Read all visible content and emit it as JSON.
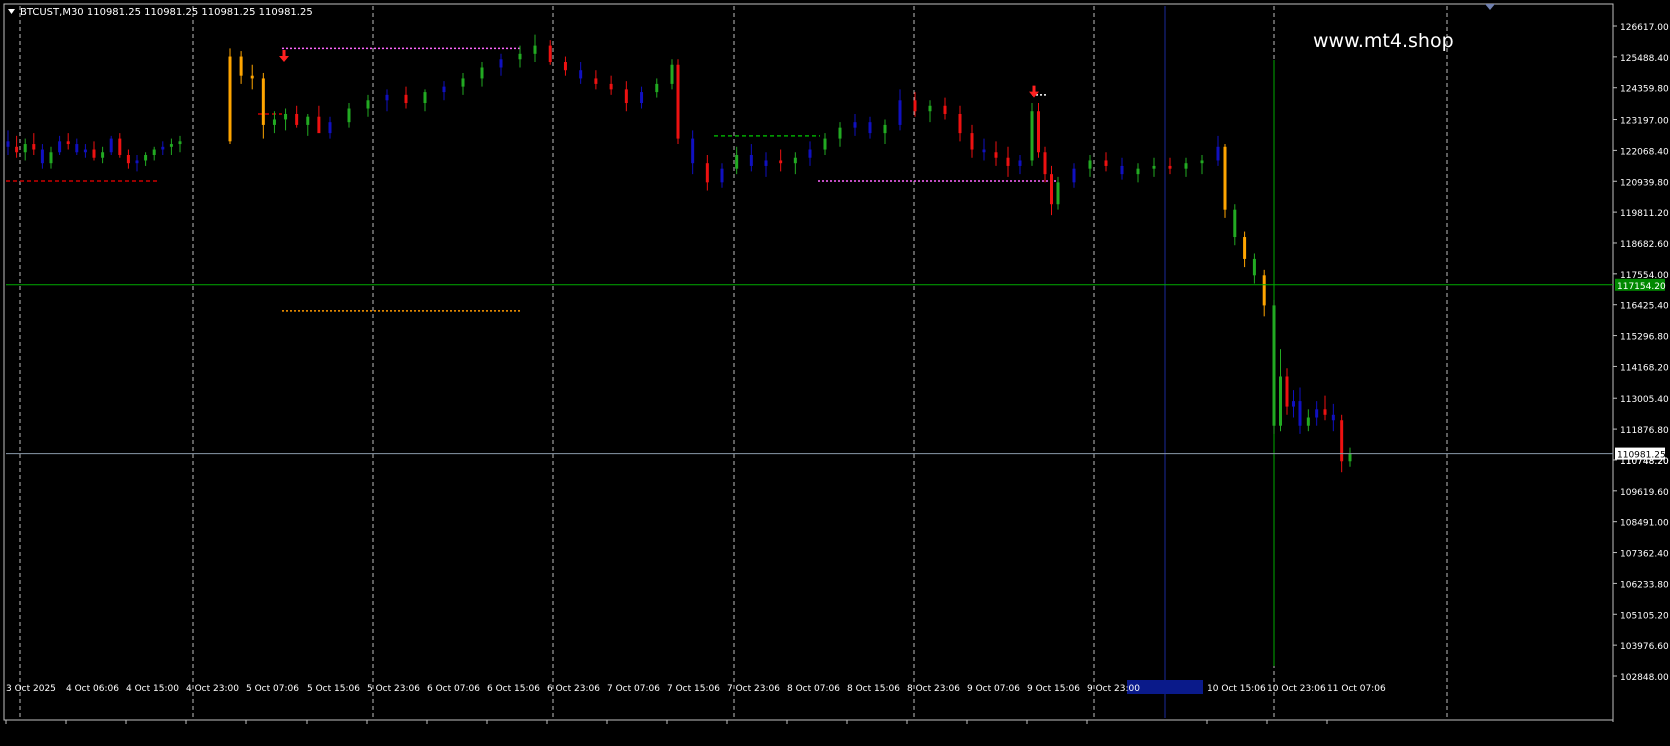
{
  "header": {
    "symbol_info": "BTCUST,M30  110981.25 110981.25 110981.25 110981.25",
    "menu_icon": "triangle-down-icon",
    "top_marker_icon": "triangle-down-icon"
  },
  "watermark": "www.mt4.shop",
  "chart_data": {
    "type": "candlestick",
    "symbol": "BTCUST",
    "timeframe": "M30",
    "ohlc": {
      "open": 110981.25,
      "high": 110981.25,
      "low": 110981.25,
      "close": 110981.25
    },
    "ylim": [
      102848.0,
      126900.0
    ],
    "y_ticks": [
      126617.0,
      125488.4,
      124359.8,
      123197.0,
      122068.4,
      120939.8,
      119811.2,
      118682.6,
      117554.0,
      116425.4,
      115296.8,
      114168.2,
      113005.4,
      111876.8,
      110748.2,
      109619.6,
      108491.0,
      107362.4,
      106233.8,
      105105.2,
      103976.6,
      102848.0
    ],
    "y_tick_labels": [
      "126617.00",
      "125488.40",
      "124359.80",
      "123197.00",
      "122068.40",
      "120939.80",
      "119811.20",
      "118682.60",
      "117554.00",
      "116425.40",
      "115296.80",
      "114168.20",
      "113005.40",
      "111876.80",
      "110748.20",
      "109619.60",
      "108491.00",
      "107362.40",
      "106233.80",
      "105105.20",
      "103976.60",
      "102848.00"
    ],
    "x_labels": [
      "3 Oct 2025",
      "4 Oct 06:06",
      "4 Oct 15:00",
      "4 Oct 23:00",
      "5 Oct 07:06",
      "5 Oct 15:06",
      "5 Oct 23:06",
      "6 Oct 07:06",
      "6 Oct 15:06",
      "6 Oct 23:06",
      "7 Oct 07:06",
      "7 Oct 15:06",
      "7 Oct 23:06",
      "8 Oct 07:06",
      "8 Oct 15:06",
      "8 Oct 23:06",
      "9 Oct 07:06",
      "9 Oct 15:06",
      "9 Oct 23:00",
      "10 Oct 15:06",
      "10 Oct 23:06",
      "11 Oct 07:06"
    ],
    "current_price": 110981.25,
    "current_price_label": "110981.25",
    "green_level": 117154.2,
    "green_level_label": "117154.20",
    "overlay_price_label": "110748.20",
    "candles": [
      [
        0,
        122400,
        122800,
        121900,
        122200
      ],
      [
        1,
        122200,
        122600,
        121800,
        122000
      ],
      [
        2,
        122000,
        122500,
        121700,
        122300
      ],
      [
        3,
        122300,
        122700,
        121900,
        122100
      ],
      [
        4,
        122100,
        122300,
        121400,
        121600
      ],
      [
        5,
        121600,
        122200,
        121400,
        122000
      ],
      [
        6,
        122000,
        122600,
        121900,
        122400
      ],
      [
        7,
        122400,
        122700,
        122100,
        122300
      ],
      [
        8,
        122300,
        122500,
        121900,
        122000
      ],
      [
        9,
        122000,
        122300,
        121800,
        122100
      ],
      [
        10,
        122100,
        122400,
        121700,
        121800
      ],
      [
        11,
        121800,
        122200,
        121600,
        122000
      ],
      [
        12,
        122000,
        122600,
        121900,
        122500
      ],
      [
        13,
        122500,
        122700,
        121800,
        121900
      ],
      [
        14,
        121900,
        122100,
        121400,
        121600
      ],
      [
        15,
        121600,
        121900,
        121300,
        121700
      ],
      [
        16,
        121700,
        122000,
        121500,
        121900
      ],
      [
        17,
        121900,
        122200,
        121700,
        122100
      ],
      [
        18,
        122100,
        122400,
        121900,
        122200
      ],
      [
        19,
        122200,
        122500,
        121900,
        122300
      ],
      [
        20,
        122300,
        122600,
        122000,
        122400
      ],
      [
        21,
        122400,
        125800,
        122300,
        125500
      ],
      [
        22,
        125500,
        125700,
        124500,
        124800
      ],
      [
        23,
        124800,
        125200,
        124300,
        124700
      ],
      [
        24,
        124700,
        124900,
        122500,
        123000
      ],
      [
        25,
        123000,
        123500,
        122700,
        123200
      ],
      [
        26,
        123200,
        123600,
        122800,
        123400
      ],
      [
        27,
        123400,
        123700,
        122900,
        123000
      ],
      [
        28,
        123000,
        123400,
        122600,
        123300
      ],
      [
        29,
        123300,
        123700,
        122900,
        122700
      ],
      [
        30,
        122700,
        123300,
        122500,
        123100
      ],
      [
        31,
        123100,
        123800,
        122900,
        123600
      ],
      [
        32,
        123600,
        124100,
        123300,
        123900
      ],
      [
        33,
        123900,
        124300,
        123500,
        124100
      ],
      [
        34,
        124100,
        124400,
        123600,
        123800
      ],
      [
        35,
        123800,
        124300,
        123500,
        124200
      ],
      [
        36,
        124200,
        124600,
        123900,
        124400
      ],
      [
        37,
        124400,
        124900,
        124100,
        124700
      ],
      [
        38,
        124700,
        125300,
        124400,
        125100
      ],
      [
        39,
        125100,
        125600,
        124800,
        125400
      ],
      [
        40,
        125400,
        125900,
        125100,
        125600
      ],
      [
        41,
        125600,
        126300,
        125300,
        125900
      ],
      [
        42,
        125900,
        126100,
        125200,
        125300
      ],
      [
        43,
        125300,
        125500,
        124800,
        125000
      ],
      [
        44,
        125000,
        125300,
        124500,
        124700
      ],
      [
        45,
        124700,
        125000,
        124300,
        124500
      ],
      [
        46,
        124500,
        124800,
        124100,
        124300
      ],
      [
        47,
        124300,
        124600,
        123500,
        123800
      ],
      [
        48,
        123800,
        124400,
        123600,
        124200
      ],
      [
        49,
        124200,
        124700,
        124000,
        124500
      ],
      [
        50,
        124500,
        125400,
        124300,
        125200
      ],
      [
        51,
        125200,
        125400,
        122300,
        122500
      ],
      [
        52,
        122500,
        122800,
        121200,
        121600
      ],
      [
        53,
        121600,
        121900,
        120600,
        120900
      ],
      [
        54,
        120900,
        121600,
        120700,
        121400
      ],
      [
        55,
        121400,
        122200,
        121200,
        121900
      ],
      [
        56,
        121900,
        122300,
        121300,
        121500
      ],
      [
        57,
        121500,
        122000,
        121100,
        121700
      ],
      [
        58,
        121700,
        122100,
        121300,
        121600
      ],
      [
        59,
        121600,
        122000,
        121200,
        121800
      ],
      [
        60,
        121800,
        122400,
        121500,
        122100
      ],
      [
        61,
        122100,
        122700,
        121900,
        122500
      ],
      [
        62,
        122500,
        123100,
        122200,
        122900
      ],
      [
        63,
        122900,
        123400,
        122600,
        123100
      ],
      [
        64,
        123100,
        123300,
        122500,
        122700
      ],
      [
        65,
        122700,
        123200,
        122300,
        123000
      ],
      [
        66,
        123000,
        124300,
        122800,
        123900
      ],
      [
        67,
        123900,
        124200,
        123300,
        123500
      ],
      [
        68,
        123500,
        123900,
        123100,
        123700
      ],
      [
        69,
        123700,
        124000,
        123200,
        123400
      ],
      [
        70,
        123400,
        123700,
        122400,
        122700
      ],
      [
        71,
        122700,
        123000,
        121800,
        122100
      ],
      [
        72,
        122100,
        122500,
        121700,
        122000
      ],
      [
        73,
        122000,
        122400,
        121500,
        121800
      ],
      [
        74,
        121800,
        122200,
        121100,
        121500
      ],
      [
        75,
        121500,
        121900,
        121200,
        121700
      ],
      [
        76,
        121700,
        123800,
        121500,
        123500
      ],
      [
        77,
        123500,
        123800,
        121800,
        122000
      ],
      [
        78,
        122000,
        122200,
        120900,
        121200
      ],
      [
        79,
        121200,
        121500,
        119700,
        120100
      ],
      [
        80,
        120100,
        121100,
        119900,
        120900
      ],
      [
        81,
        120900,
        121600,
        120700,
        121400
      ],
      [
        82,
        121400,
        121900,
        121100,
        121700
      ],
      [
        83,
        121700,
        122000,
        121300,
        121500
      ],
      [
        84,
        121500,
        121800,
        121000,
        121200
      ],
      [
        85,
        121200,
        121600,
        120900,
        121400
      ],
      [
        86,
        121400,
        121800,
        121100,
        121500
      ],
      [
        87,
        121500,
        121800,
        121200,
        121400
      ],
      [
        88,
        121400,
        121800,
        121100,
        121600
      ],
      [
        89,
        121600,
        121900,
        121200,
        121700
      ],
      [
        90,
        121700,
        122600,
        121500,
        122200
      ],
      [
        91,
        122200,
        122300,
        119600,
        119900
      ],
      [
        92,
        119900,
        120100,
        118600,
        118900
      ],
      [
        93,
        118900,
        119100,
        117800,
        118100
      ],
      [
        94,
        118100,
        118300,
        117200,
        117500
      ],
      [
        95,
        117500,
        117700,
        116000,
        116400
      ],
      [
        96,
        116400,
        116600,
        111700,
        112000
      ],
      [
        97,
        112000,
        114800,
        111800,
        113800
      ],
      [
        98,
        113800,
        114100,
        112400,
        112700
      ],
      [
        99,
        112700,
        113300,
        112300,
        112900
      ],
      [
        100,
        112900,
        113400,
        111700,
        112000
      ],
      [
        101,
        112000,
        112600,
        111800,
        112300
      ],
      [
        102,
        112300,
        112900,
        112000,
        112600
      ],
      [
        103,
        112600,
        113100,
        112200,
        112400
      ],
      [
        104,
        112400,
        112800,
        111800,
        112200
      ],
      [
        105,
        112200,
        112400,
        110300,
        110700
      ],
      [
        106,
        110700,
        111200,
        110500,
        110981
      ]
    ],
    "levels": [
      {
        "price": 120950,
        "from": 0,
        "to": 20,
        "color": "#cc0000",
        "style": "dash"
      },
      {
        "price": 125800,
        "from": 37,
        "to": 68,
        "color": "#ff66ff",
        "style": "dot"
      },
      {
        "price": 116200,
        "from": 37,
        "to": 68,
        "color": "#ff9900",
        "style": "dot"
      },
      {
        "price": 123400,
        "from": 34,
        "to": 37,
        "color": "#cc0000",
        "style": "dash"
      },
      {
        "price": 122600,
        "from": 95,
        "to": 109,
        "color": "#00aa00",
        "style": "dash"
      },
      {
        "price": 120950,
        "from": 109,
        "to": 140,
        "color": "#ff66ff",
        "style": "dot"
      },
      {
        "price": 124100,
        "from": 137,
        "to": 140,
        "color": "#ffffff",
        "style": "dot"
      }
    ],
    "arrows": [
      {
        "price": 125300,
        "time": 37,
        "color": "#ff2020"
      },
      {
        "price": 124000,
        "time": 138,
        "color": "#ff2020"
      }
    ]
  }
}
